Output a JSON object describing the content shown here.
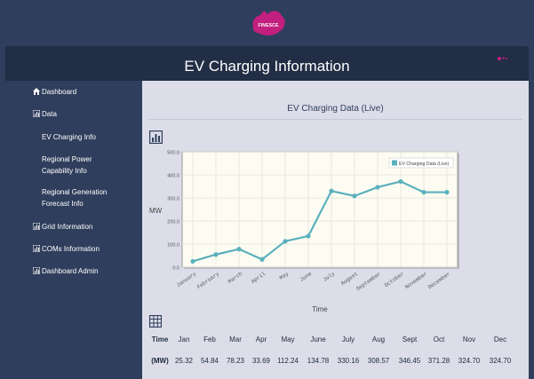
{
  "logo": {
    "text": "FINESCE",
    "color": "#c21f7f"
  },
  "header": {
    "title": "EV Charging Information"
  },
  "sidebar": {
    "items": [
      {
        "label": "Dashboard",
        "icon": "dashboard-icon"
      },
      {
        "label": "Data",
        "icon": "bar-chart-icon"
      },
      {
        "label": "Grid Information",
        "icon": "bar-chart-icon"
      },
      {
        "label": "COMs Information",
        "icon": "bar-chart-icon"
      },
      {
        "label": "Dashboard Admin",
        "icon": "bar-chart-icon"
      }
    ],
    "subitems": [
      {
        "label": "EV Charging Info"
      },
      {
        "label": "Regional Power Capability Info"
      },
      {
        "label": "Regional Generation Forecast Info"
      }
    ]
  },
  "main": {
    "title": "EV Charging Data (Live)"
  },
  "colors": {
    "line": "#5ab1bd",
    "plot_bg": "#fdfcf2",
    "header_bg": "#222e45",
    "sidebar_bg": "#2f3e5c",
    "main_bg": "#dcdde9"
  },
  "chart_data": {
    "type": "line",
    "categories": [
      "January",
      "February",
      "March",
      "April",
      "May",
      "June",
      "July",
      "August",
      "September",
      "October",
      "November",
      "December"
    ],
    "series": [
      {
        "name": "EV Charging Data (Live)",
        "values": [
          25.32,
          54.84,
          78.23,
          33.69,
          112.24,
          134.78,
          330.16,
          308.57,
          346.45,
          371.28,
          324.7,
          324.7
        ]
      }
    ],
    "xlabel": "Time",
    "ylabel": "MW",
    "ylim": [
      0,
      500
    ],
    "yticks": [
      "0.0",
      "100.0",
      "200.0",
      "300.0",
      "400.0",
      "500.0"
    ],
    "grid": true,
    "legend": "top-right"
  },
  "table": {
    "header": [
      "Time",
      "Jan",
      "Feb",
      "Mar",
      "Apr",
      "May",
      "June",
      "July",
      "Aug",
      "Sept",
      "Oct",
      "Nov",
      "Dec"
    ],
    "row": [
      "(MW)",
      "25.32",
      "54.84",
      "78.23",
      "33.69",
      "112.24",
      "134.78",
      "330.16",
      "308.57",
      "346.45",
      "371.28",
      "324.70",
      "324.70"
    ]
  }
}
